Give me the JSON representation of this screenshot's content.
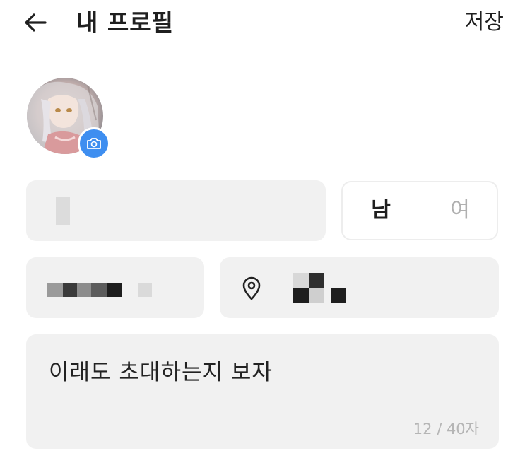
{
  "header": {
    "title": "내 프로필",
    "save_label": "저장",
    "back_icon": "arrow-left-icon"
  },
  "profile": {
    "camera_icon": "camera-icon",
    "accent_color": "#3e8ef0"
  },
  "gender": {
    "male_label": "남",
    "female_label": "여",
    "selected": "남"
  },
  "location": {
    "icon": "location-pin-icon"
  },
  "bio": {
    "value": "이래도 초대하는지 보자",
    "counter": "12 / 40자"
  }
}
